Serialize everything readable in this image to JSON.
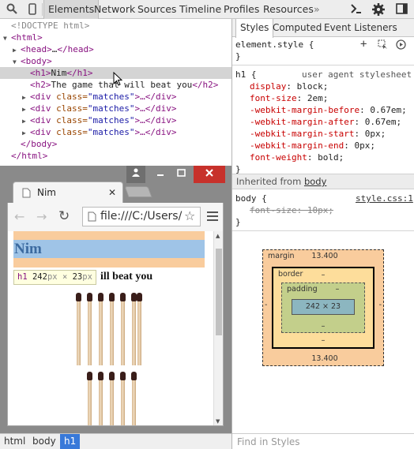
{
  "toolbar": {
    "tabs": [
      "Elements",
      "Network",
      "Sources",
      "Timeline",
      "Profiles",
      "Resources"
    ],
    "more": "»"
  },
  "elements": {
    "lines": [
      {
        "doctype": "<!DOCTYPE html>"
      },
      {
        "open": "<html>"
      },
      {
        "head_open": "<head>",
        "ellipsis": "…",
        "head_close": "</head>"
      },
      {
        "open": "<body>"
      },
      {
        "h1_open": "<h1>",
        "text": "Nim",
        "h1_close": "</h1>"
      },
      {
        "h2_open": "<h2>",
        "text": "The game that will beat you",
        "h2_close": "</h2>"
      },
      {
        "div_open": "<div ",
        "attr": "class=",
        "val": "\"matches\"",
        "rest": ">…</div>"
      },
      {
        "div_open": "<div ",
        "attr": "class=",
        "val": "\"matches\"",
        "rest": ">…</div>"
      },
      {
        "div_open": "<div ",
        "attr": "class=",
        "val": "\"matches\"",
        "rest": ">…</div>"
      },
      {
        "div_open": "<div ",
        "attr": "class=",
        "val": "\"matches\"",
        "rest": ">…</div>"
      },
      {
        "close": "</body>"
      },
      {
        "close": "</html>"
      }
    ]
  },
  "styles": {
    "tabs": [
      "Styles",
      "Computed",
      "Event Listeners"
    ],
    "element_style": "element.style {",
    "close_brace": "}",
    "h1_rule": {
      "selector": "h1 {",
      "source": "user agent stylesheet",
      "props": [
        {
          "name": "display",
          "value": "block;"
        },
        {
          "name": "font-size",
          "value": "2em;"
        },
        {
          "name": "-webkit-margin-before",
          "value": "0.67em;"
        },
        {
          "name": "-webkit-margin-after",
          "value": "0.67em;"
        },
        {
          "name": "-webkit-margin-start",
          "value": "0px;"
        },
        {
          "name": "-webkit-margin-end",
          "value": "0px;"
        },
        {
          "name": "font-weight",
          "value": "bold;"
        }
      ]
    },
    "inherited_label": "Inherited from",
    "inherited_from": "body",
    "body_rule": {
      "selector": "body {",
      "source": "style.css:1",
      "prop": "font-size: 10px;"
    },
    "box_model": {
      "margin_label": "margin",
      "margin_top": "13.400",
      "margin_bottom": "13.400",
      "margin_side": "-",
      "border_label": "border",
      "border_val": "–",
      "padding_label": "padding",
      "padding_val": "–",
      "content": "242 × 23"
    },
    "find_placeholder": "Find in Styles"
  },
  "breadcrumbs": [
    "html",
    "body",
    "h1"
  ],
  "browser": {
    "tab_title": "Nim",
    "url": "file:///C:/Users/",
    "h1": "Nim",
    "tooltip_tag": "h1",
    "tooltip_w": "242",
    "tooltip_h": "23",
    "tooltip_unit": "px",
    "tooltip_x": "×",
    "h2_visible": "ill beat you"
  }
}
